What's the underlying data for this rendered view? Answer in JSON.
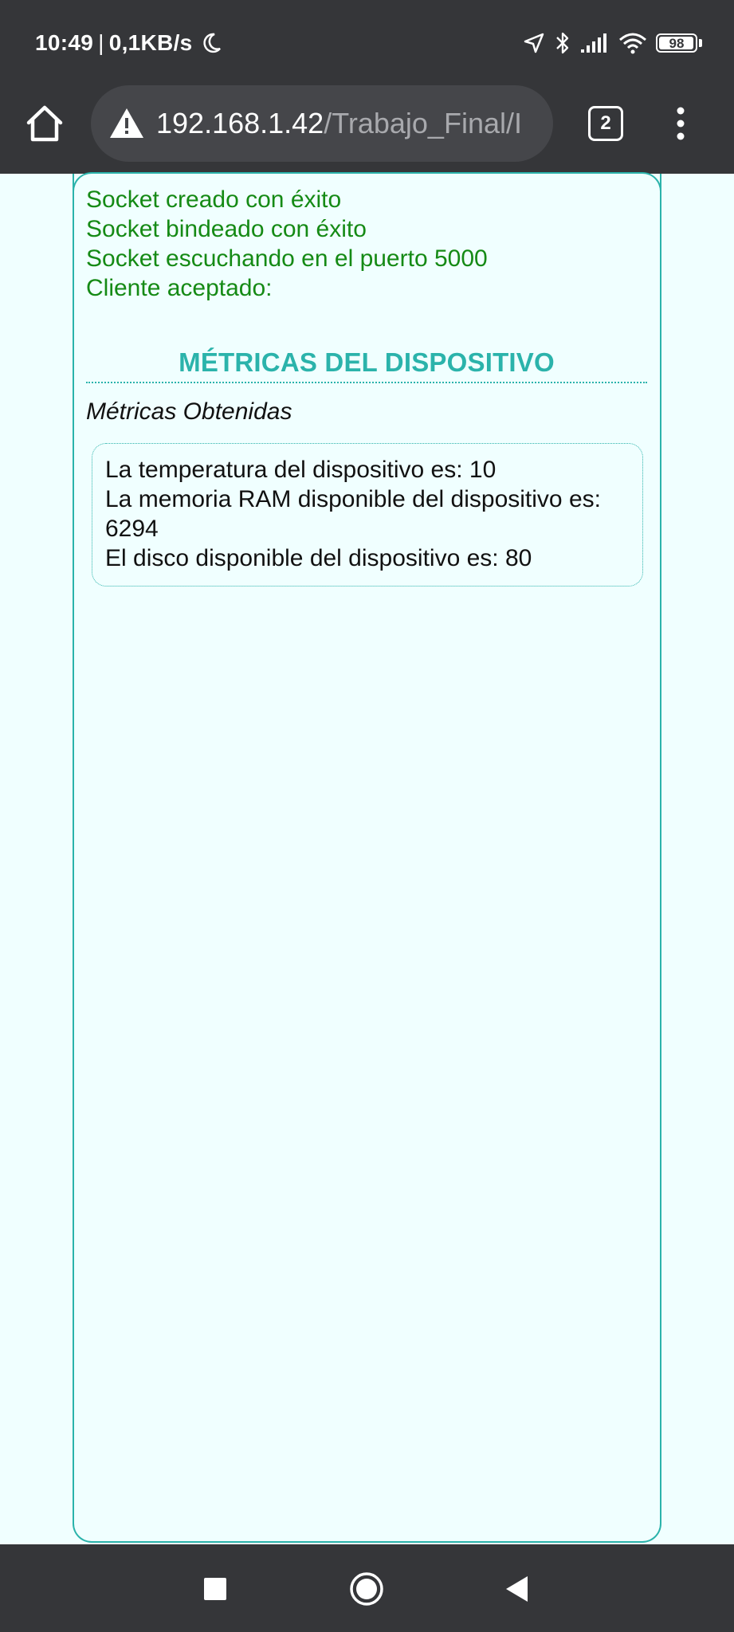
{
  "status_bar": {
    "time": "10:49",
    "data_rate": "0,1KB/s",
    "battery": "98",
    "battery_level": 0.98
  },
  "browser": {
    "url_host": "192.168.1.42",
    "url_path": "/Trabajo_Final/I",
    "tab_count": "2"
  },
  "page": {
    "log_lines": [
      "Socket creado con éxito",
      "Socket bindeado con éxito",
      "Socket escuchando en el puerto 5000",
      "Cliente aceptado:"
    ],
    "metrics_title": "MÉTRICAS DEL DISPOSITIVO",
    "metrics_subtitle": "Métricas Obtenidas",
    "metrics": {
      "temperature": "La temperatura del dispositivo es: 10",
      "ram_line1": "La memoria RAM disponible del dispositivo es:",
      "ram_line2": "6294",
      "disk": "El disco disponible del dispositivo es: 80"
    }
  },
  "colors": {
    "chrome_bg": "#353639",
    "page_bg": "#f0ffff",
    "accent": "#2bb3ab",
    "log_green": "#158a15"
  }
}
